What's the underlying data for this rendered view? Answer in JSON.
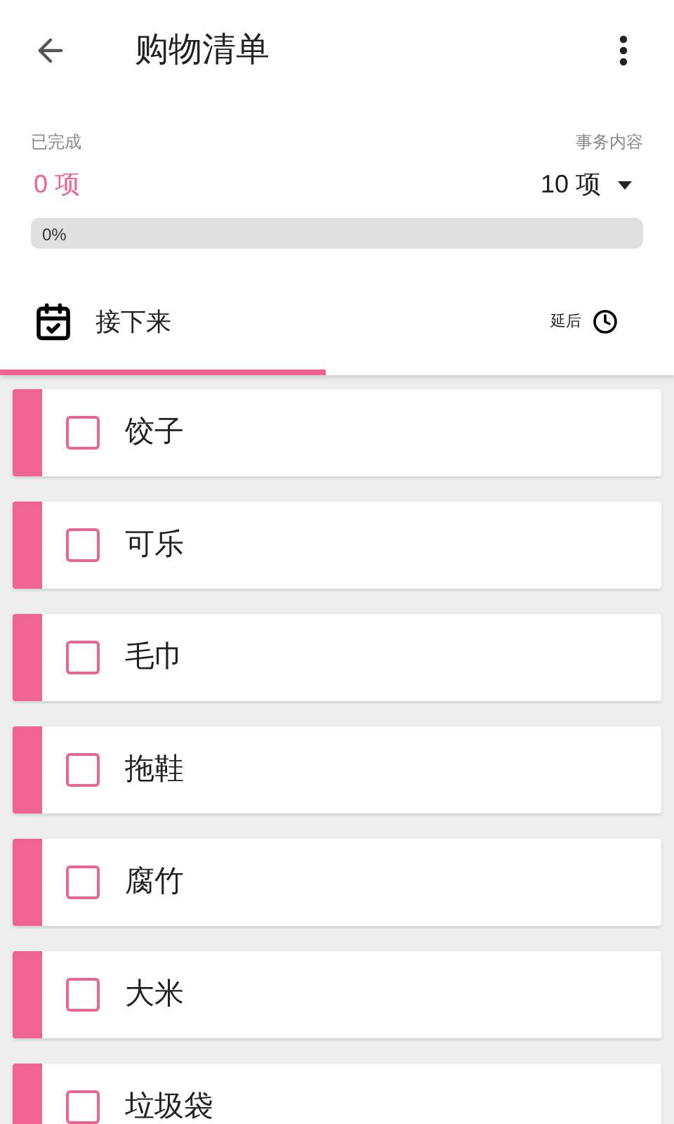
{
  "app_bar": {
    "title": "购物清单"
  },
  "summary": {
    "done_label": "已完成",
    "done_count": "0 项",
    "total_label": "事务内容",
    "total_count": "10 项",
    "progress": {
      "level": 0,
      "reading": "0%"
    }
  },
  "tabs": [
    {
      "label": "接下来",
      "selected": true
    },
    {
      "label": "延后",
      "selected": false
    }
  ],
  "items": [
    {
      "label": "饺子",
      "checked": false
    },
    {
      "label": "可乐",
      "checked": false
    },
    {
      "label": "毛巾",
      "checked": false
    },
    {
      "label": "拖鞋",
      "checked": false
    },
    {
      "label": "腐竹",
      "checked": false
    },
    {
      "label": "大米",
      "checked": false
    },
    {
      "label": "垃圾袋",
      "checked": false
    }
  ]
}
